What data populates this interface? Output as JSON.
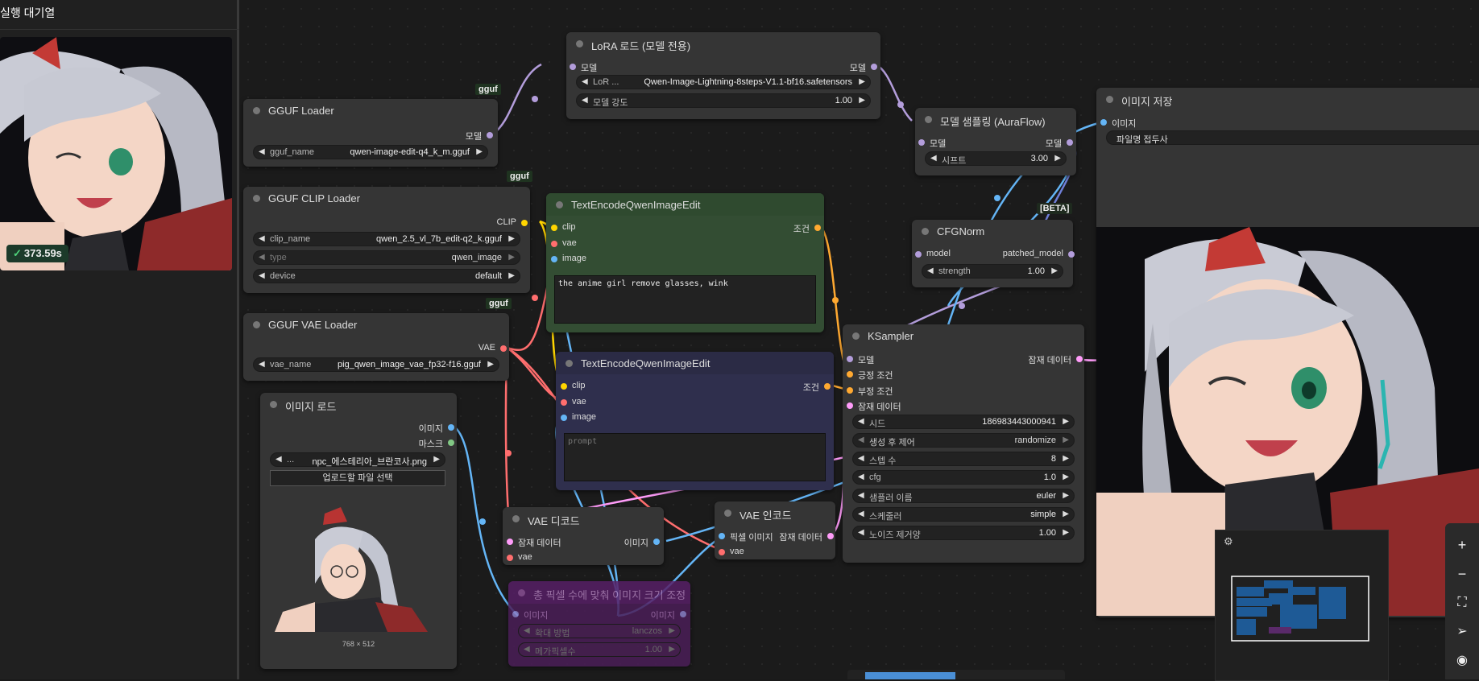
{
  "queue": {
    "title": "실행 대기열",
    "elapsed": "373.59s"
  },
  "tags": {
    "gguf1": "gguf",
    "gguf2": "gguf",
    "gguf3": "gguf",
    "beta": "[BETA]"
  },
  "nodes": {
    "gguf_loader": {
      "title": "GGUF Loader",
      "out_model": "모델",
      "w1_label": "gguf_name",
      "w1_value": "qwen-image-edit-q4_k_m.gguf"
    },
    "gguf_clip": {
      "title": "GGUF CLIP Loader",
      "out_clip": "CLIP",
      "w1_label": "clip_name",
      "w1_value": "qwen_2.5_vl_7b_edit-q2_k.gguf",
      "w2_label": "type",
      "w2_value": "qwen_image",
      "w3_label": "device",
      "w3_value": "default"
    },
    "gguf_vae": {
      "title": "GGUF VAE Loader",
      "out_vae": "VAE",
      "w1_label": "vae_name",
      "w1_value": "pig_qwen_image_vae_fp32-f16.gguf"
    },
    "image_load": {
      "title": "이미지 로드",
      "out_image": "이미지",
      "out_mask": "마스크",
      "w1_label": "...",
      "w1_value": "npc_에스테리아_브란코사.png",
      "upload": "업로드할 파일 선택",
      "dims": "768 × 512"
    },
    "lora": {
      "title": "LoRA 로드 (모델 전용)",
      "in_model": "모델",
      "out_model": "모델",
      "w1_label": "LoR ...",
      "w1_value": "Qwen-Image-Lightning-8steps-V1.1-bf16.safetensors",
      "w2_label": "모델 강도",
      "w2_value": "1.00"
    },
    "text_pos": {
      "title": "TextEncodeQwenImageEdit",
      "in_clip": "clip",
      "in_vae": "vae",
      "in_image": "image",
      "out_cond": "조건",
      "text": "the anime girl remove glasses, wink"
    },
    "text_neg": {
      "title": "TextEncodeQwenImageEdit",
      "in_clip": "clip",
      "in_vae": "vae",
      "in_image": "image",
      "out_cond": "조건",
      "placeholder": "prompt"
    },
    "sampling": {
      "title": "모델 샘플링 (AuraFlow)",
      "in_model": "모델",
      "out_model": "모델",
      "w1_label": "시프트",
      "w1_value": "3.00"
    },
    "cfgnorm": {
      "title": "CFGNorm",
      "in_model": "model",
      "out_model": "patched_model",
      "w1_label": "strength",
      "w1_value": "1.00"
    },
    "ksampler": {
      "title": "KSampler",
      "in_model": "모델",
      "in_pos": "긍정 조건",
      "in_neg": "부정 조건",
      "in_latent": "잠재 데이터",
      "out_latent": "잠재 데이터",
      "widgets": [
        {
          "label": "시드",
          "value": "186983443000941"
        },
        {
          "label": "생성 후 제어",
          "value": "randomize"
        },
        {
          "label": "스텝 수",
          "value": "8"
        },
        {
          "label": "cfg",
          "value": "1.0"
        },
        {
          "label": "샘플러 이름",
          "value": "euler"
        },
        {
          "label": "스케줄러",
          "value": "simple"
        },
        {
          "label": "노이즈 제거양",
          "value": "1.00"
        }
      ]
    },
    "vae_decode": {
      "title": "VAE 디코드",
      "in_latent": "잠재 데이터",
      "in_vae": "vae",
      "out_image": "이미지"
    },
    "vae_encode": {
      "title": "VAE 인코드",
      "in_pixels": "픽셀 이미지",
      "in_vae": "vae",
      "out_latent": "잠재 데이터"
    },
    "image_save": {
      "title": "이미지 저장",
      "in_image": "이미지",
      "w1_value": "파일명 접두사"
    },
    "scale": {
      "title": "총 픽셀 수에 맞춰 이미지 크기 조정",
      "in_image": "이미지",
      "out_image": "이미지",
      "w1_label": "확대 방법",
      "w1_value": "lanczos",
      "w2_label": "메가픽셀수",
      "w2_value": "1.00"
    }
  },
  "colors": {
    "model": "#b39ddb",
    "clip": "#ffd500",
    "vae": "#ff6e6e",
    "image": "#64b5f6",
    "latent": "#ff9cf9",
    "conditioning": "#ffa931",
    "mask": "#81c784"
  },
  "tools": [
    "zoom-in-icon",
    "zoom-out-icon",
    "fit-view-icon",
    "navigate-icon",
    "visibility-icon"
  ]
}
